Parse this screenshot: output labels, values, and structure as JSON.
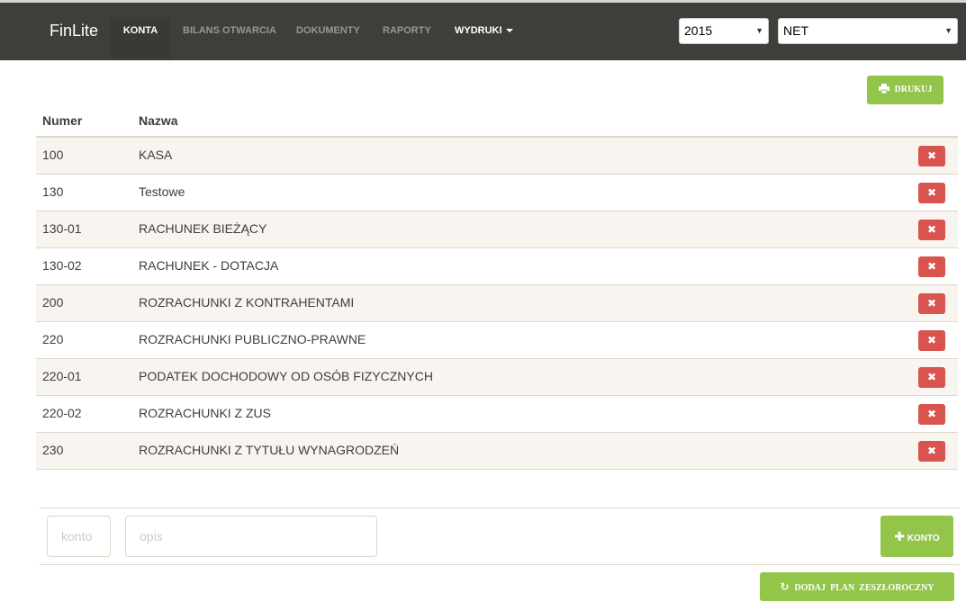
{
  "app": {
    "brand": "FinLite"
  },
  "nav": {
    "items": [
      {
        "label": "KONTA"
      },
      {
        "label": "BILANS OTWARCIA"
      },
      {
        "label": "DOKUMENTY"
      },
      {
        "label": "RAPORTY"
      },
      {
        "label": "WYDRUKI"
      }
    ]
  },
  "filters": {
    "year": "2015",
    "company": "NET"
  },
  "toolbar": {
    "print_label": "DRUKUJ"
  },
  "table": {
    "headers": [
      "Numer",
      "Nazwa"
    ],
    "rows": [
      {
        "numer": "100",
        "nazwa": "KASA"
      },
      {
        "numer": "130",
        "nazwa": "Testowe"
      },
      {
        "numer": "130-01",
        "nazwa": "RACHUNEK BIEŻĄCY"
      },
      {
        "numer": "130-02",
        "nazwa": "RACHUNEK - DOTACJA"
      },
      {
        "numer": "200",
        "nazwa": "ROZRACHUNKI Z KONTRAHENTAMI"
      },
      {
        "numer": "220",
        "nazwa": "ROZRACHUNKI PUBLICZNO-PRAWNE"
      },
      {
        "numer": "220-01",
        "nazwa": "PODATEK DOCHODOWY OD OSÓB FIZYCZNYCH"
      },
      {
        "numer": "220-02",
        "nazwa": "ROZRACHUNKI Z ZUS"
      },
      {
        "numer": "230",
        "nazwa": "ROZRACHUNKI Z TYTUŁU WYNAGRODZEŃ"
      }
    ]
  },
  "form": {
    "konto_placeholder": "konto",
    "opis_placeholder": "opis",
    "add_label": "KONTO",
    "plan_label": "DODAJ  PLAN  ZESZŁOROCZNY"
  },
  "colors": {
    "navbar": "#3e3f3a",
    "success": "#93c54b",
    "danger": "#d9534f",
    "row_stripe": "#f8f5f0"
  },
  "icons": {
    "print": "print-icon",
    "delete": "times-icon",
    "add": "plus-icon",
    "refresh": "refresh-icon",
    "dropdown": "caret-down-icon"
  }
}
